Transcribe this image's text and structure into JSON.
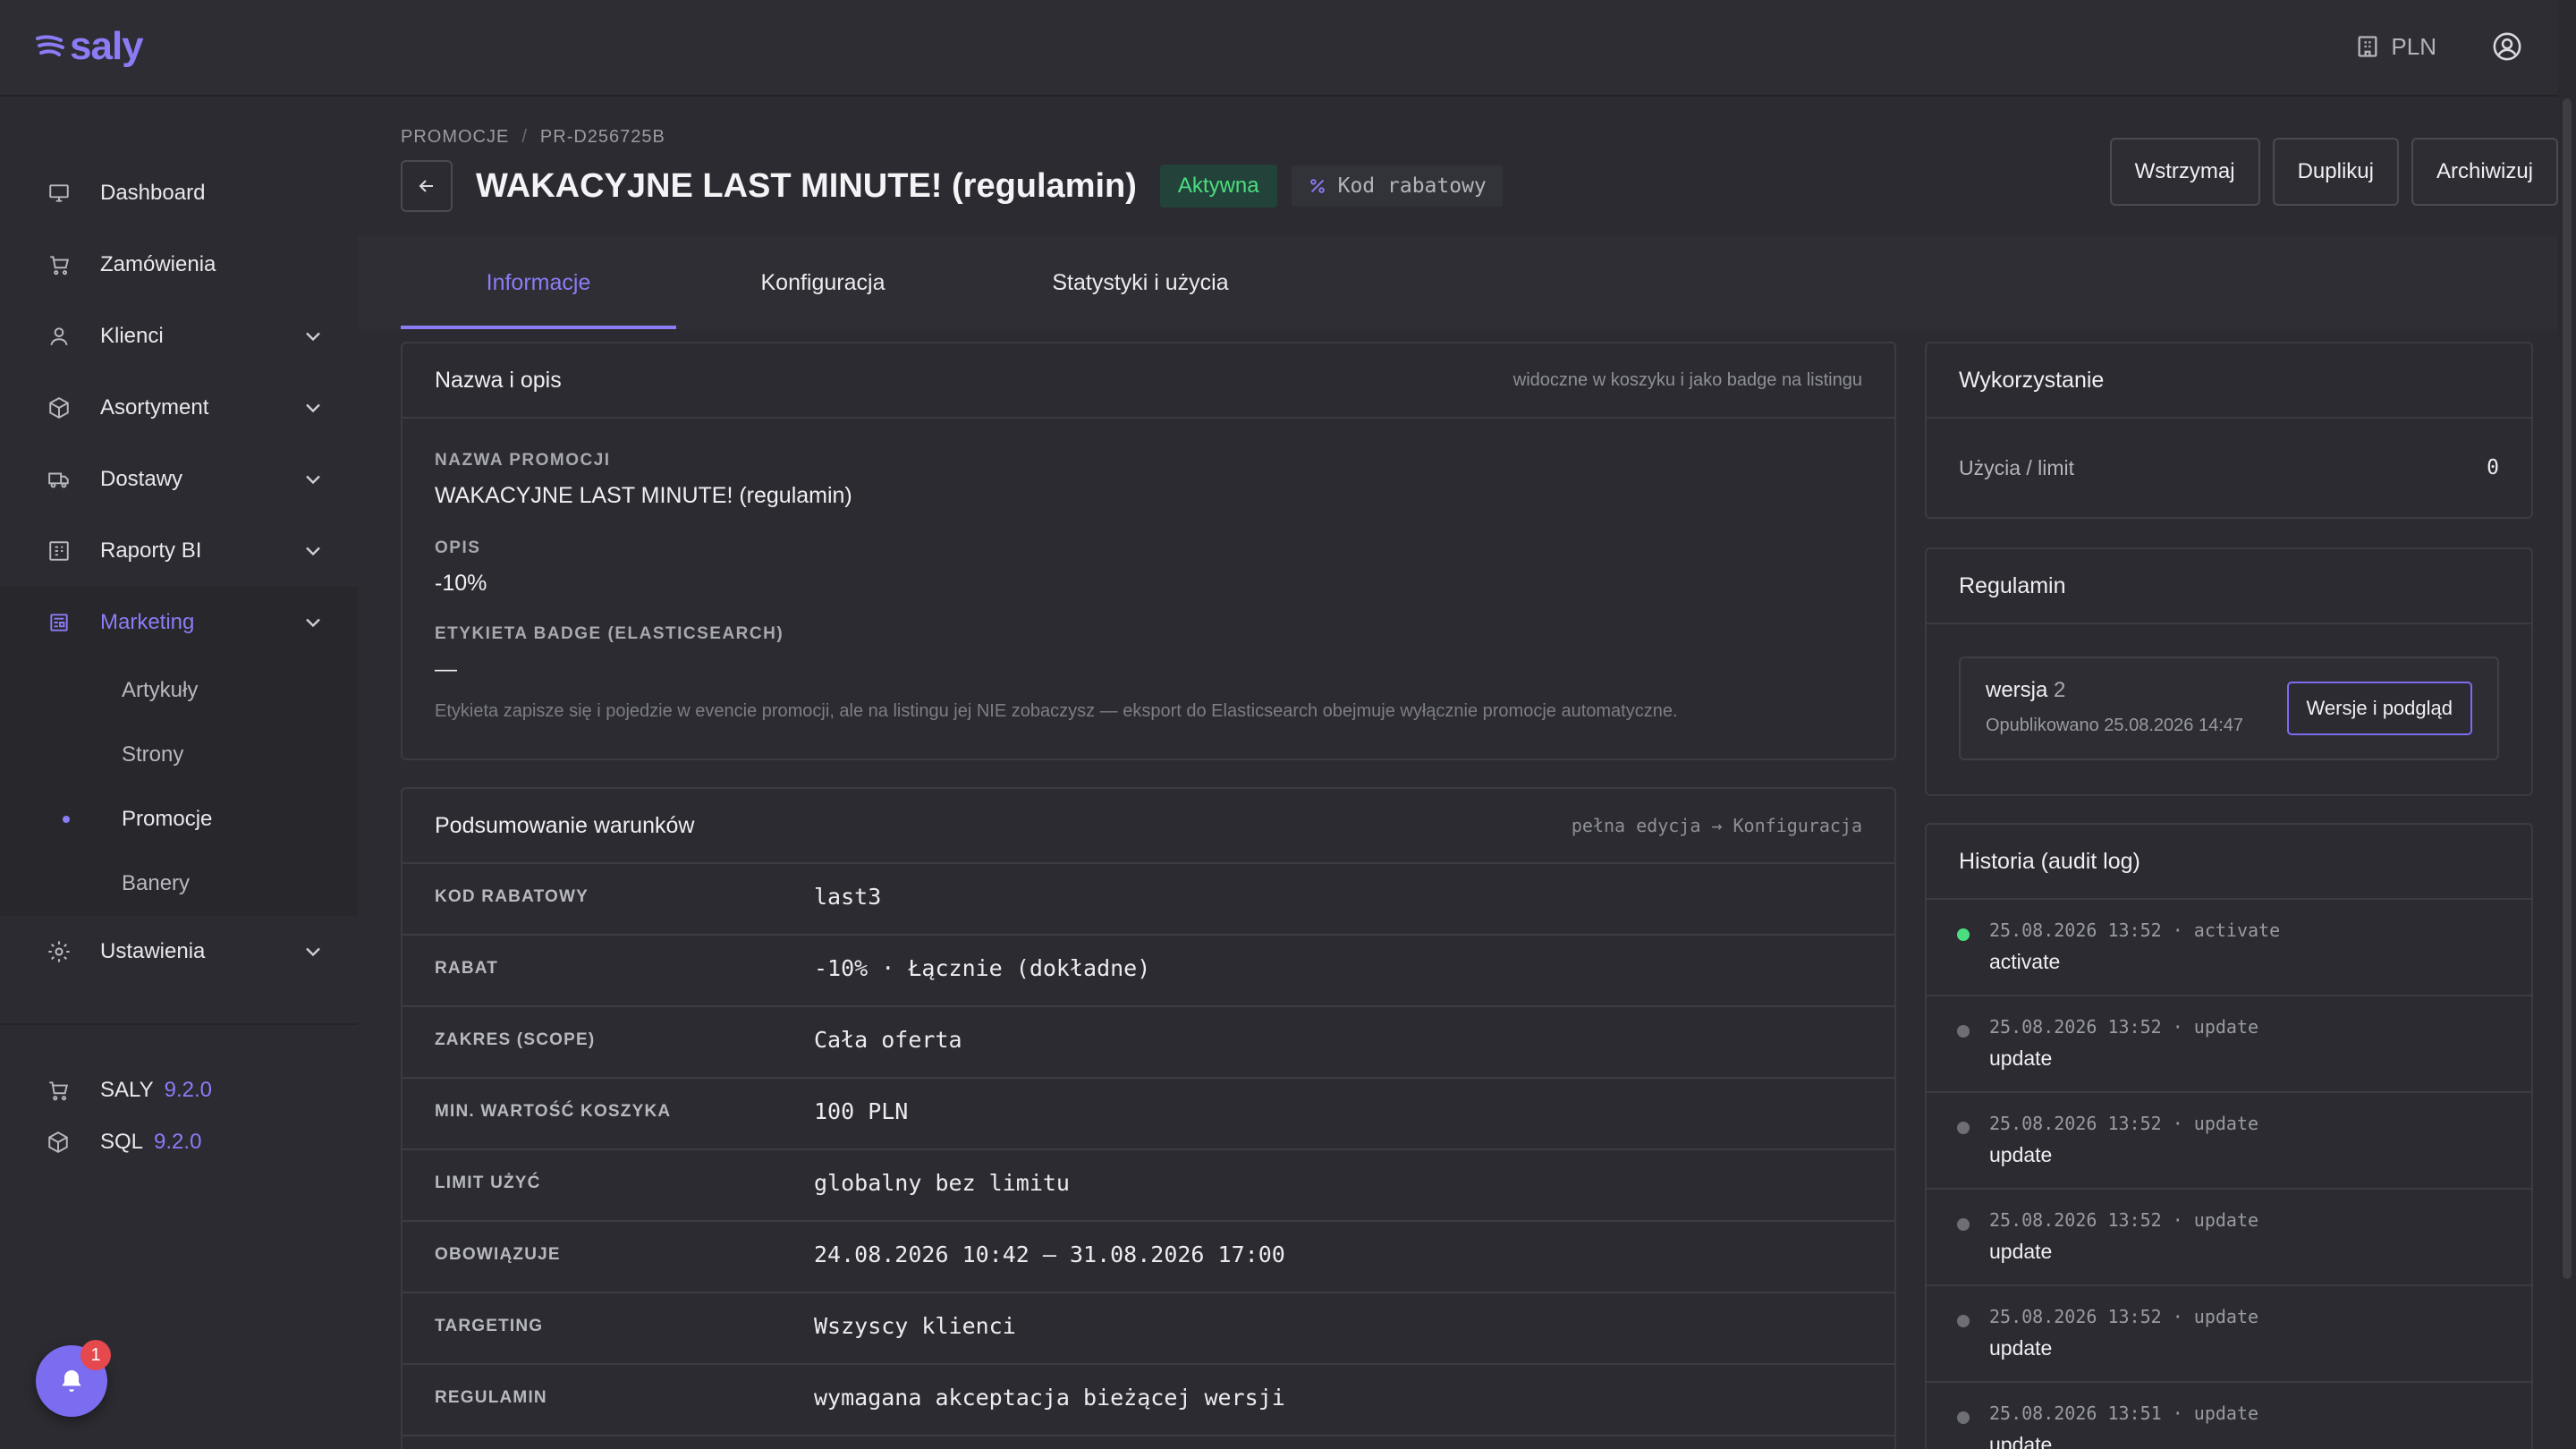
{
  "app": {
    "logo": "saly",
    "currency": "PLN"
  },
  "sidebar": {
    "items": [
      {
        "label": "Dashboard"
      },
      {
        "label": "Zamówienia"
      },
      {
        "label": "Klienci"
      },
      {
        "label": "Asortyment"
      },
      {
        "label": "Dostawy"
      },
      {
        "label": "Raporty BI"
      },
      {
        "label": "Marketing"
      },
      {
        "label": "Ustawienia"
      }
    ],
    "marketing_sub": [
      {
        "label": "Artykuły"
      },
      {
        "label": "Strony"
      },
      {
        "label": "Promocje"
      },
      {
        "label": "Banery"
      }
    ],
    "versions": [
      {
        "name": "SALY",
        "version": "9.2.0"
      },
      {
        "name": "SQL",
        "version": "9.2.0"
      }
    ],
    "notification_count": "1"
  },
  "header": {
    "breadcrumb": [
      "PROMOCJE",
      "/",
      "PR-D256725B"
    ],
    "title": "WAKACYJNE LAST MINUTE! (regulamin)",
    "status": "Aktywna",
    "type": "Kod rabatowy",
    "actions": [
      "Wstrzymaj",
      "Duplikuj",
      "Archiwizuj"
    ]
  },
  "tabs": [
    "Informacje",
    "Konfiguracja",
    "Statystyki i użycia"
  ],
  "name_card": {
    "title": "Nazwa i opis",
    "hint": "widoczne w koszyku i jako badge na listingu",
    "fields": [
      {
        "label": "NAZWA PROMOCJI",
        "value": "WAKACYJNE LAST MINUTE! (regulamin)"
      },
      {
        "label": "OPIS",
        "value": "-10%"
      },
      {
        "label": "ETYKIETA BADGE (ELASTICSEARCH)",
        "value": "—"
      }
    ],
    "help": "Etykieta zapisze się i pojedzie w evencie promocji, ale na listingu jej NIE zobaczysz — eksport do Elasticsearch obejmuje wyłącznie promocje automatyczne."
  },
  "summary_card": {
    "title": "Podsumowanie warunków",
    "hint": "pełna edycja → Konfiguracja",
    "rows": [
      {
        "k": "KOD RABATOWY",
        "v": "last3"
      },
      {
        "k": "RABAT",
        "v": "-10% · Łącznie (dokładne)"
      },
      {
        "k": "ZAKRES (SCOPE)",
        "v": "Cała oferta"
      },
      {
        "k": "MIN. WARTOŚĆ KOSZYKA",
        "v": "100 PLN"
      },
      {
        "k": "LIMIT UŻYĆ",
        "v": "globalny bez limitu"
      },
      {
        "k": "OBOWIĄZUJE",
        "v": "24.08.2026 10:42 – 31.08.2026 17:00"
      },
      {
        "k": "TARGETING",
        "v": "Wszyscy klienci"
      },
      {
        "k": "REGULAMIN",
        "v": "wymagana akceptacja bieżącej wersji"
      }
    ]
  },
  "usage_card": {
    "title": "Wykorzystanie",
    "label": "Użycia / limit",
    "value": "0"
  },
  "terms_card": {
    "title": "Regulamin",
    "version_label": "wersja",
    "version_number": "2",
    "published": "Opublikowano 25.08.2026 14:47",
    "button": "Wersje i podgląd"
  },
  "history_card": {
    "title": "Historia (audit log)",
    "entries": [
      {
        "meta": "25.08.2026 13:52 · activate",
        "action": "activate",
        "color": "#4ade80"
      },
      {
        "meta": "25.08.2026 13:52 · update",
        "action": "update",
        "color": "#6e6e76"
      },
      {
        "meta": "25.08.2026 13:52 · update",
        "action": "update",
        "color": "#6e6e76"
      },
      {
        "meta": "25.08.2026 13:52 · update",
        "action": "update",
        "color": "#6e6e76"
      },
      {
        "meta": "25.08.2026 13:52 · update",
        "action": "update",
        "color": "#6e6e76"
      },
      {
        "meta": "25.08.2026 13:51 · update",
        "action": "update",
        "color": "#6e6e76"
      }
    ]
  },
  "colors": {
    "accent": "#8b7cf6",
    "active_status": "#4ade80",
    "background": "#2b2b31"
  }
}
